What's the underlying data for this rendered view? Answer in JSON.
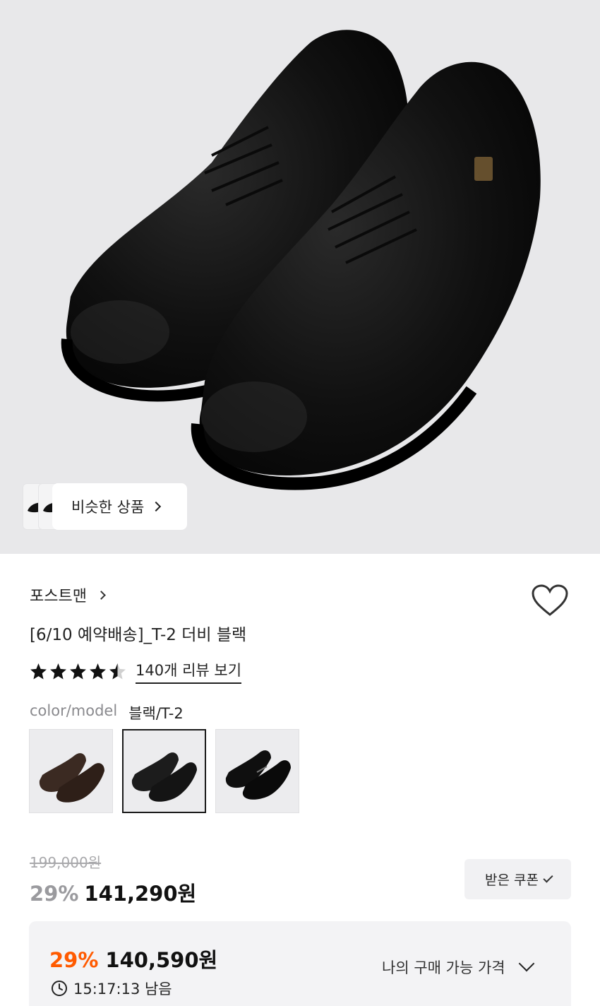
{
  "hero": {
    "image": "product-photo-black-derby-shoes",
    "similar_label": "비슷한 상품"
  },
  "product": {
    "brand": "포스트맨",
    "title": "[6/10 예약배송]_T-2 더비 블랙",
    "rating": 4.5,
    "review_link": "140개 리뷰 보기"
  },
  "options": {
    "color_label": "color/model",
    "color_value": "블랙/T-2",
    "swatches": [
      {
        "name": "brown",
        "color": "#3b2a22"
      },
      {
        "name": "black",
        "color": "#1c1c1c",
        "selected": true
      },
      {
        "name": "black-glossy",
        "color": "#0f0f0f"
      }
    ]
  },
  "price": {
    "original": "199,000원",
    "discount": "29%",
    "sale": "141,290원",
    "coupon_label": "받은 쿠폰"
  },
  "my_price": {
    "discount": "29%",
    "price": "140,590원",
    "timer": "15:17:13 남음",
    "toggle_label": "나의 구매 가능 가격"
  },
  "colors": {
    "accent": "#ff5a00",
    "hero_bg": "#e8e8ea"
  }
}
